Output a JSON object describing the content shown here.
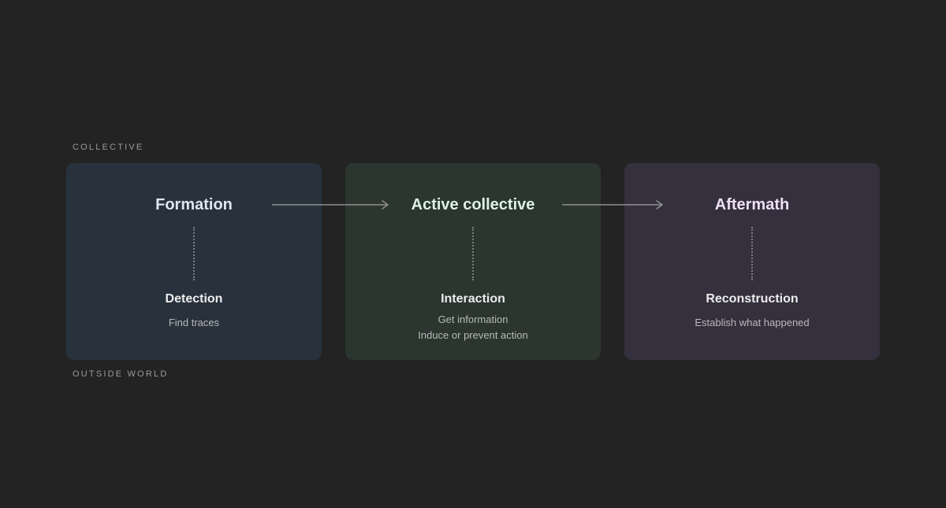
{
  "bands": {
    "top": "COLLECTIVE",
    "bottom": "OUTSIDE WORLD"
  },
  "stages": [
    {
      "title": "Formation",
      "sub_title": "Detection",
      "description": [
        "Find traces"
      ]
    },
    {
      "title": "Active collective",
      "sub_title": "Interaction",
      "description": [
        "Get information",
        "Induce or prevent action"
      ]
    },
    {
      "title": "Aftermath",
      "sub_title": "Reconstruction",
      "description": [
        "Establish what happened"
      ]
    }
  ],
  "colors": {
    "background": "#232323",
    "formation_panel": "#28323d",
    "active_panel": "#2a362f",
    "aftermath_panel": "#35303d",
    "arrow": "#8f8f8f"
  }
}
